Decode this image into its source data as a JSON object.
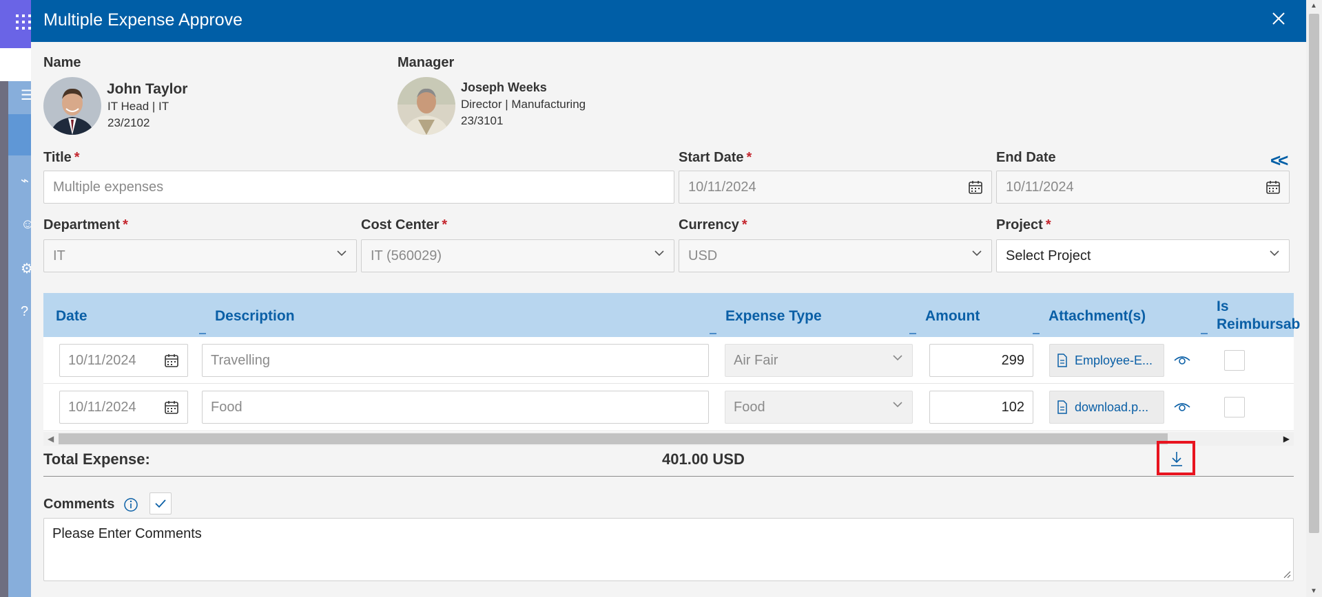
{
  "modal": {
    "title": "Multiple Expense Approve",
    "close_icon": "close-icon"
  },
  "employee": {
    "label": "Name",
    "name": "John Taylor",
    "role": "IT Head | IT",
    "id": "23/2102"
  },
  "manager": {
    "label": "Manager",
    "name": "Joseph Weeks",
    "role": "Director | Manufacturing",
    "id": "23/3101"
  },
  "form": {
    "title": {
      "label": "Title",
      "value": "Multiple expenses",
      "required": "*"
    },
    "start_date": {
      "label": "Start Date",
      "value": "10/11/2024",
      "required": "*"
    },
    "end_date": {
      "label": "End Date",
      "value": "10/11/2024"
    },
    "department": {
      "label": "Department",
      "value": "IT",
      "required": "*"
    },
    "cost_center": {
      "label": "Cost Center",
      "value": "IT (560029)",
      "required": "*"
    },
    "currency": {
      "label": "Currency",
      "value": "USD",
      "required": "*"
    },
    "project": {
      "label": "Project",
      "value": "Select Project",
      "required": "*"
    },
    "collapse_glyph": "<<"
  },
  "grid": {
    "columns": [
      "Date",
      "Description",
      "Expense Type",
      "Amount",
      "Attachment(s)",
      "Is",
      "Reimbursab"
    ],
    "rows": [
      {
        "date": "10/11/2024",
        "description": "Travelling",
        "expense_type": "Air Fair",
        "amount": "299",
        "attachment": "Employee-E..."
      },
      {
        "date": "10/11/2024",
        "description": "Food",
        "expense_type": "Food",
        "amount": "102",
        "attachment": "download.p..."
      }
    ]
  },
  "total": {
    "label": "Total Expense:",
    "value": "401.00 USD"
  },
  "comments": {
    "label": "Comments",
    "value": "Please Enter Comments"
  },
  "colors": {
    "header_blue": "#005ea6",
    "grid_header": "#b8d6ef",
    "highlight_red": "#e8141f"
  }
}
